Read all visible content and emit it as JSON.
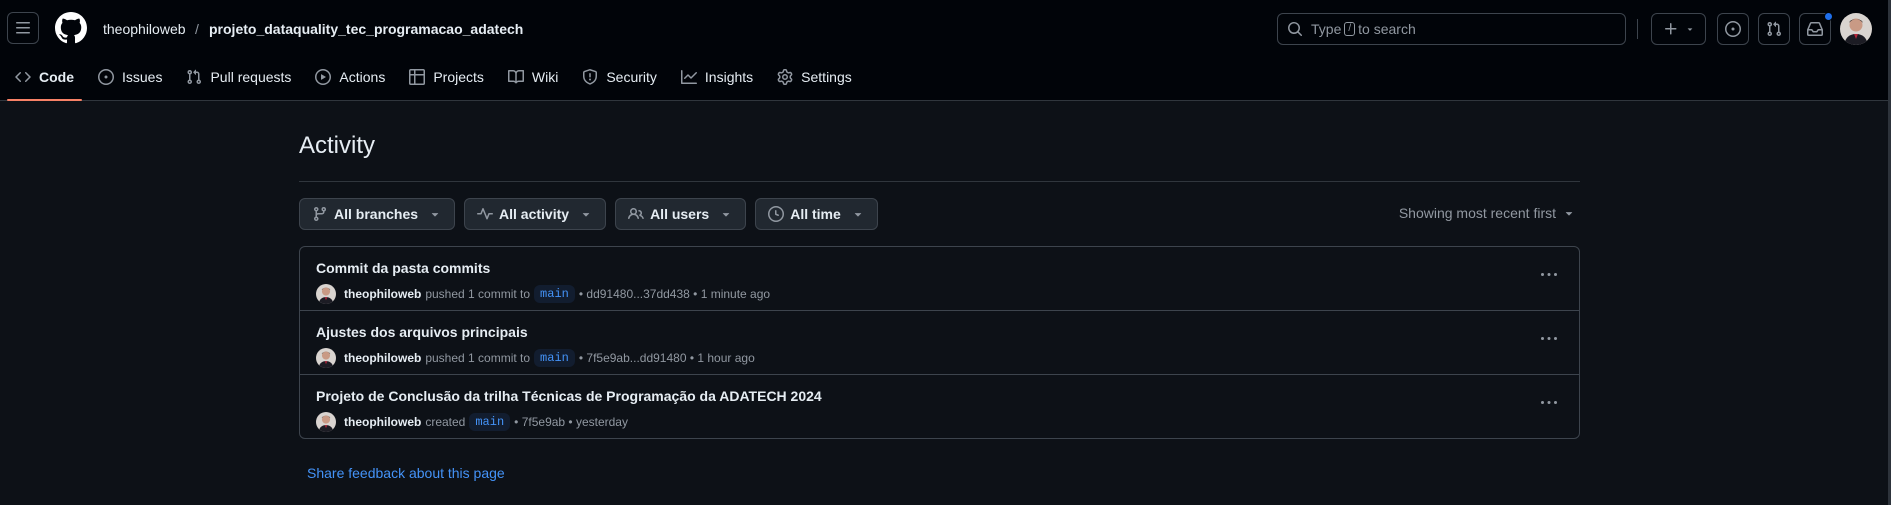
{
  "header": {
    "owner": "theophiloweb",
    "separator": "/",
    "repo": "projeto_dataquality_tec_programacao_adatech",
    "search_prefix": "Type",
    "search_key": "/",
    "search_suffix": "to search"
  },
  "tabs": [
    {
      "label": "Code",
      "icon": "code-icon",
      "selected": true
    },
    {
      "label": "Issues",
      "icon": "issue-opened-icon"
    },
    {
      "label": "Pull requests",
      "icon": "git-pull-request-icon"
    },
    {
      "label": "Actions",
      "icon": "play-icon"
    },
    {
      "label": "Projects",
      "icon": "table-icon"
    },
    {
      "label": "Wiki",
      "icon": "book-icon"
    },
    {
      "label": "Security",
      "icon": "shield-icon"
    },
    {
      "label": "Insights",
      "icon": "graph-icon"
    },
    {
      "label": "Settings",
      "icon": "gear-icon"
    }
  ],
  "page": {
    "title": "Activity",
    "sort_label": "Showing most recent first",
    "feedback_link": "Share feedback about this page"
  },
  "filters": [
    {
      "label": "All branches",
      "icon": "git-branch-icon"
    },
    {
      "label": "All activity",
      "icon": "pulse-icon"
    },
    {
      "label": "All users",
      "icon": "people-icon"
    },
    {
      "label": "All time",
      "icon": "clock-icon"
    }
  ],
  "activity": [
    {
      "title": "Commit da pasta commits",
      "author": "theophiloweb",
      "action": "pushed 1 commit to",
      "branch": "main",
      "detail": "• dd91480...37dd438 • 1 minute ago"
    },
    {
      "title": "Ajustes dos arquivos principais",
      "author": "theophiloweb",
      "action": "pushed 1 commit to",
      "branch": "main",
      "detail": "• 7f5e9ab...dd91480 • 1 hour ago"
    },
    {
      "title": "Projeto de Conclusão da trilha Técnicas de Programação da ADATECH 2024",
      "author": "theophiloweb",
      "action": "created",
      "branch": "main",
      "detail": "• 7f5e9ab • yesterday"
    }
  ],
  "colors": {
    "background": "#0d1117",
    "header_background": "#010409",
    "accent_link": "#4493f8",
    "selected_tab_underline": "#f78166",
    "notification_dot": "#1f6feb"
  }
}
